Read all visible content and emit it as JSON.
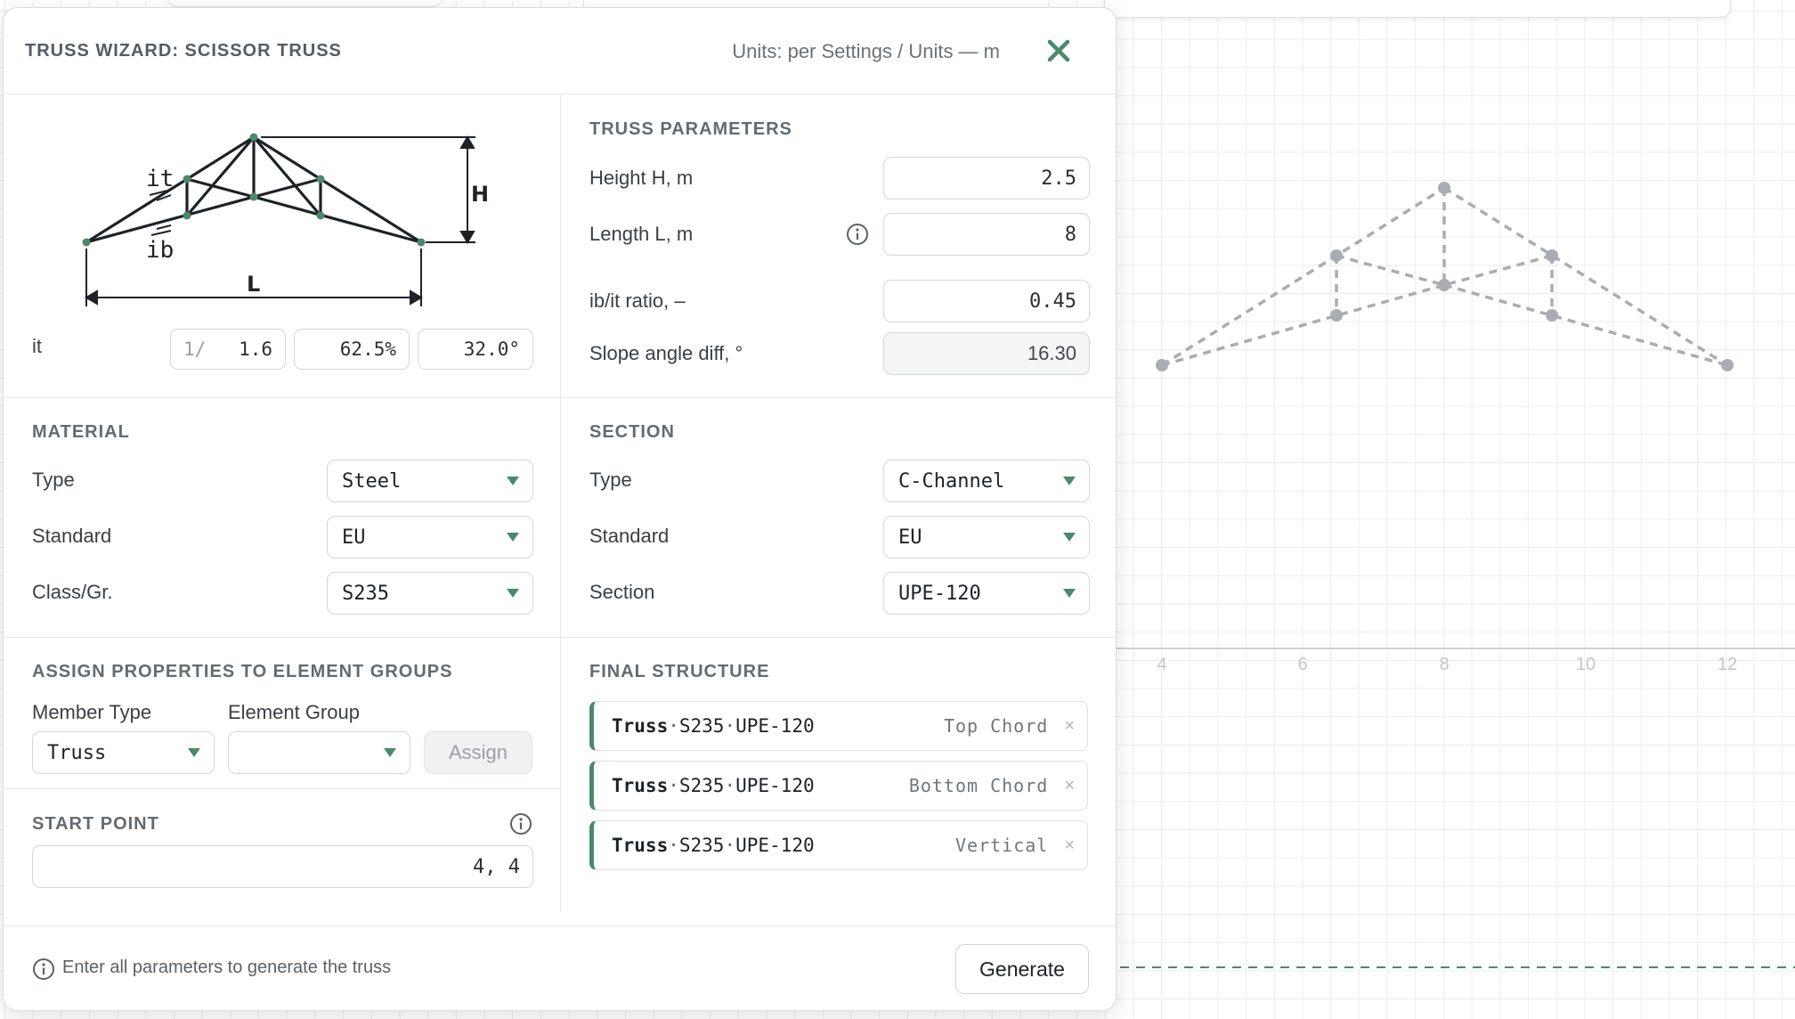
{
  "dialog": {
    "title": "TRUSS WIZARD: SCISSOR TRUSS",
    "units": "Units: per Settings / Units — m"
  },
  "diagram": {
    "label_it": "it",
    "label_ib": "ib",
    "label_H": "H",
    "label_L": "L"
  },
  "slope": {
    "label": "it",
    "ratio_prefix": "1/",
    "ratio_value": "1.6",
    "percent": "62.5%",
    "angle": "32.0°"
  },
  "truss_params": {
    "title": "TRUSS PARAMETERS",
    "height_label": "Height H, m",
    "height_value": "2.5",
    "length_label": "Length L, m",
    "length_value": "8",
    "ratio_label": "ib/it ratio, –",
    "ratio_value": "0.45",
    "slope_diff_label": "Slope angle diff, °",
    "slope_diff_value": "16.30"
  },
  "material": {
    "title": "MATERIAL",
    "type_label": "Type",
    "type_value": "Steel",
    "standard_label": "Standard",
    "standard_value": "EU",
    "class_label": "Class/Gr.",
    "class_value": "S235"
  },
  "section": {
    "title": "SECTION",
    "type_label": "Type",
    "type_value": "C-Channel",
    "standard_label": "Standard",
    "standard_value": "EU",
    "section_label": "Section",
    "section_value": "UPE-120"
  },
  "assign": {
    "title": "ASSIGN PROPERTIES TO ELEMENT GROUPS",
    "member_type_label": "Member Type",
    "member_type_value": "Truss",
    "element_group_label": "Element Group",
    "element_group_value": "",
    "button": "Assign"
  },
  "start_point": {
    "title": "START POINT",
    "value": "4, 4"
  },
  "final_structure": {
    "title": "FINAL STRUCTURE",
    "rows": [
      {
        "name": "Truss",
        "material": "S235",
        "section": "UPE-120",
        "member": "Top Chord",
        "remove": "×"
      },
      {
        "name": "Truss",
        "material": "S235",
        "section": "UPE-120",
        "member": "Bottom Chord",
        "remove": "×"
      },
      {
        "name": "Truss",
        "material": "S235",
        "section": "UPE-120",
        "member": "Vertical",
        "remove": "×"
      }
    ]
  },
  "footer": {
    "hint": "Enter all parameters to generate the truss",
    "generate": "Generate"
  },
  "canvas": {
    "axis_ticks": [
      "4",
      "6",
      "8",
      "10",
      "12"
    ],
    "preview_color": "#a9adb2",
    "accent_color": "#4a8a6a"
  }
}
